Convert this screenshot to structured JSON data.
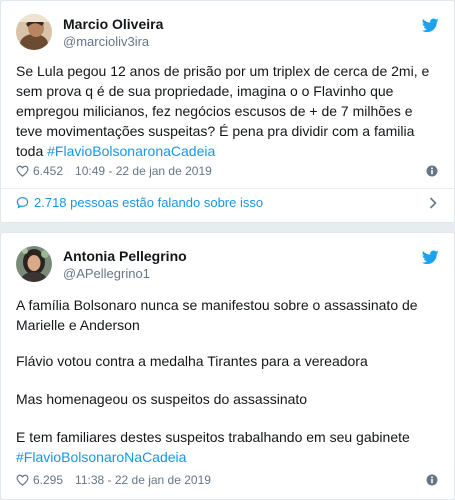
{
  "tweets": [
    {
      "author": {
        "name": "Marcio Oliveira",
        "handle": "@marcioliv3ira"
      },
      "text": "Se Lula pegou 12 anos de prisão por um triplex de cerca de 2mi, e sem prova q é de sua propriedade, imagina o o Flavinho que empregou milicianos, fez negócios escusos de + de 7 milhões e teve movimentações suspeitas? É pena pra dividir com a familia toda",
      "hashtag": "#FlavioBolsonaronaCadeia",
      "likes": "6.452",
      "timestamp": "10:49 - 22 de jan de 2019",
      "conversation": "2.718 pessoas estão falando sobre isso"
    },
    {
      "author": {
        "name": "Antonia Pellegrino",
        "handle": "@APellegrino1"
      },
      "paragraphs": [
        "A família Bolsonaro nunca se manifestou sobre o assassinato de Marielle e Anderson",
        "Flávio votou contra a medalha Tirantes para a vereadora",
        "Mas homenageou os suspeitos do assassinato",
        "E tem familiares destes suspeitos trabalhando em seu gabinete"
      ],
      "hashtag": "#FlavioBolsonaroNaCadeia",
      "likes": "6.295",
      "timestamp": "11:38 - 22 de jan de 2019"
    }
  ],
  "colors": {
    "link": "#1b95e0",
    "secondary_text": "#657786",
    "primary_text": "#14171a",
    "twitter_blue": "#1da1f2"
  },
  "icons": [
    "twitter-bird-icon",
    "heart-icon",
    "info-icon",
    "reply-bubble-icon",
    "chevron-right-icon"
  ]
}
